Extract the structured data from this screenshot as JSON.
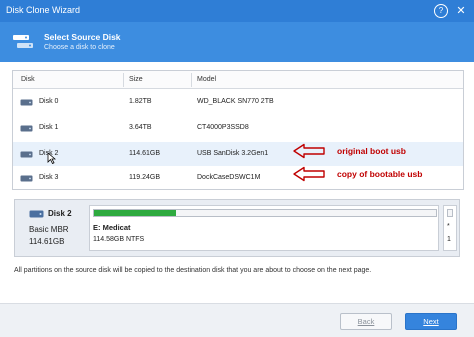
{
  "window": {
    "title": "Disk Clone Wizard",
    "help_glyph": "?",
    "close_glyph": "✕"
  },
  "header": {
    "title": "Select Source Disk",
    "subtitle": "Choose a disk to clone",
    "icon": "disk-clone-icon"
  },
  "table": {
    "columns": [
      "Disk",
      "Size",
      "Model"
    ],
    "rows": [
      {
        "disk": "Disk 0",
        "size": "1.82TB",
        "model": "WD_BLACK SN770 2TB"
      },
      {
        "disk": "Disk 1",
        "size": "3.64TB",
        "model": "CT4000P3SSD8"
      },
      {
        "disk": "Disk 2",
        "size": "114.61GB",
        "model": "USB SanDisk 3.2Gen1",
        "selected": true
      },
      {
        "disk": "Disk 3",
        "size": "119.24GB",
        "model": "DockCaseDSWC1M"
      }
    ]
  },
  "annotations": {
    "original": "original boot usb",
    "copy": "copy of bootable usb",
    "color": "#c00000"
  },
  "detail": {
    "disk_name": "Disk 2",
    "disk_type": "Basic MBR",
    "disk_size": "114.61GB",
    "partition": {
      "name": "E: Medicat",
      "info": "114.58GB NTFS",
      "used_fraction": 0.24
    },
    "small_partition": {
      "label1": "*",
      "label2": "1"
    }
  },
  "note": "All partitions on the source disk will be copied to the destination disk that you are about to choose on the next page.",
  "footer": {
    "back_label": "Back",
    "next_label": "Next"
  },
  "colors": {
    "titlebar": "#2f7ed6",
    "header": "#3d8de0",
    "accent": "#3584dd",
    "used_bar": "#2eaa3f",
    "selected_row": "#e8f1fb"
  }
}
